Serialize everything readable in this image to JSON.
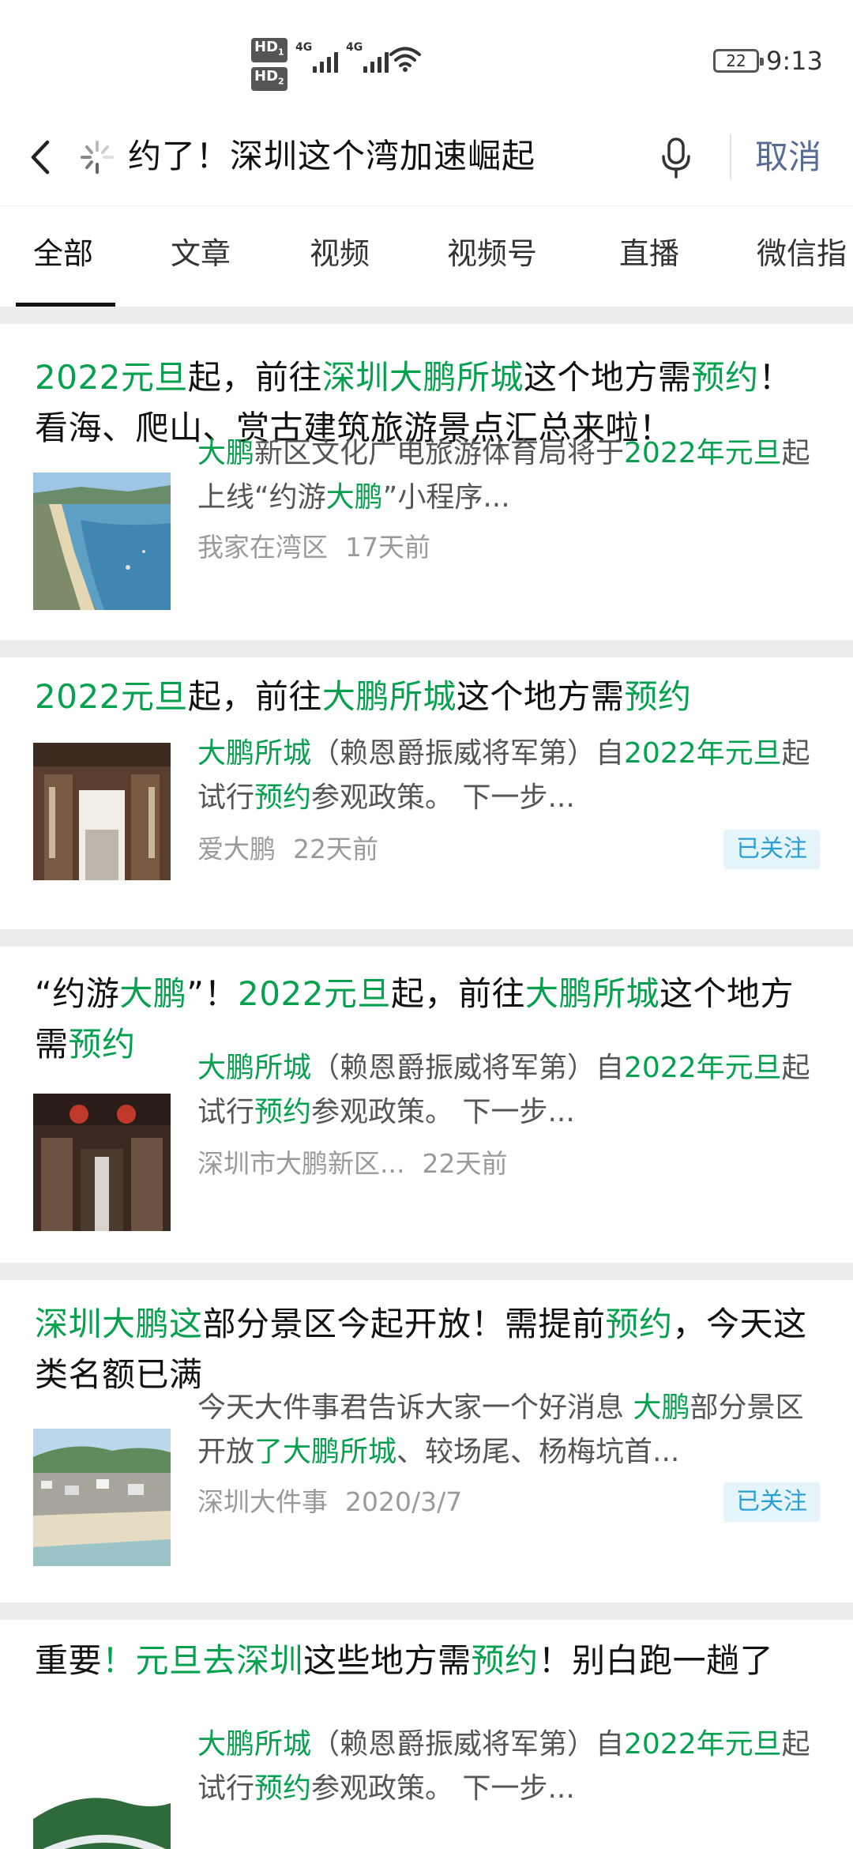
{
  "status_bar": {
    "hd1": "HD",
    "hd1_sub": "1",
    "hd2": "HD",
    "hd2_sub": "2",
    "net1": "4G",
    "net2": "4G",
    "battery": "22",
    "time": "9:13"
  },
  "search": {
    "query_visible": "约了！深圳这个湾加速崛起",
    "cancel_label": "取消"
  },
  "tabs": [
    {
      "label": "全部",
      "active": true
    },
    {
      "label": "文章",
      "active": false
    },
    {
      "label": "视频",
      "active": false
    },
    {
      "label": "视频号",
      "active": false
    },
    {
      "label": "直播",
      "active": false
    },
    {
      "label": "微信指",
      "active": false
    }
  ],
  "results": [
    {
      "title_segments": [
        {
          "text": "2022元旦",
          "hl": true
        },
        {
          "text": "起，前往",
          "hl": false
        },
        {
          "text": "深圳大鹏所城",
          "hl": true
        },
        {
          "text": "这个地方需",
          "hl": false
        },
        {
          "text": "预约",
          "hl": true
        },
        {
          "text": "！看海、爬山、赏古建筑旅游景点汇总来啦！",
          "hl": false
        }
      ],
      "desc_segments": [
        {
          "text": "大鹏",
          "hl": true
        },
        {
          "text": "新区文化广电旅游体育局将于",
          "hl": false
        },
        {
          "text": "2022年元旦",
          "hl": true
        },
        {
          "text": "起上线“约游",
          "hl": false
        },
        {
          "text": "大鹏",
          "hl": true
        },
        {
          "text": "”小程序...",
          "hl": false
        }
      ],
      "source": "我家在湾区",
      "time": "17天前",
      "followed": false,
      "thumb_icon": "coastline-photo"
    },
    {
      "title_segments": [
        {
          "text": "2022元旦",
          "hl": true
        },
        {
          "text": "起，前往",
          "hl": false
        },
        {
          "text": "大鹏所城",
          "hl": true
        },
        {
          "text": "这个地方需",
          "hl": false
        },
        {
          "text": "预约",
          "hl": true
        }
      ],
      "desc_segments": [
        {
          "text": "大鹏所城",
          "hl": true
        },
        {
          "text": "（赖恩爵振威将军第）自",
          "hl": false
        },
        {
          "text": "2022年元旦",
          "hl": true
        },
        {
          "text": "起试行",
          "hl": false
        },
        {
          "text": "预约",
          "hl": true
        },
        {
          "text": "参观政策。 下一步...",
          "hl": false
        }
      ],
      "source": "爱大鹏",
      "time": "22天前",
      "followed": true,
      "follow_label": "已关注",
      "thumb_icon": "gate-photo"
    },
    {
      "title_segments": [
        {
          "text": "“约游",
          "hl": false
        },
        {
          "text": "大鹏",
          "hl": true
        },
        {
          "text": "”！",
          "hl": false
        },
        {
          "text": "2022元旦",
          "hl": true
        },
        {
          "text": "起，前往",
          "hl": false
        },
        {
          "text": "大鹏所城",
          "hl": true
        },
        {
          "text": "这个地方需",
          "hl": false
        },
        {
          "text": "预约",
          "hl": true
        }
      ],
      "desc_segments": [
        {
          "text": "大鹏所城",
          "hl": true
        },
        {
          "text": "（赖恩爵振威将军第）自",
          "hl": false
        },
        {
          "text": "2022年元旦",
          "hl": true
        },
        {
          "text": "起试行",
          "hl": false
        },
        {
          "text": "预约",
          "hl": true
        },
        {
          "text": "参观政策。 下一步...",
          "hl": false
        }
      ],
      "source": "深圳市大鹏新区...",
      "time": "22天前",
      "followed": false,
      "thumb_icon": "lantern-gate-photo"
    },
    {
      "title_segments": [
        {
          "text": "深圳大鹏这",
          "hl": true
        },
        {
          "text": "部分景区今起开放！需提前",
          "hl": false
        },
        {
          "text": "预约",
          "hl": true
        },
        {
          "text": "，今天这类名额已满",
          "hl": false
        }
      ],
      "desc_segments": [
        {
          "text": "今天大件事君告诉大家一个好消息 ",
          "hl": false
        },
        {
          "text": "大鹏",
          "hl": true
        },
        {
          "text": "部分景区开放",
          "hl": false
        },
        {
          "text": "了大鹏所城",
          "hl": true
        },
        {
          "text": "、较场尾、杨梅坑首...",
          "hl": false
        }
      ],
      "source": "深圳大件事",
      "time": "2020/3/7",
      "followed": true,
      "follow_label": "已关注",
      "thumb_icon": "beach-town-photo"
    },
    {
      "title_segments": [
        {
          "text": "重要",
          "hl": false
        },
        {
          "text": "！元旦去深圳",
          "hl": true
        },
        {
          "text": "这些地方需",
          "hl": false
        },
        {
          "text": "预约",
          "hl": true
        },
        {
          "text": "！别白跑一趟了",
          "hl": false
        }
      ],
      "desc_segments": [
        {
          "text": "大鹏所城",
          "hl": true
        },
        {
          "text": "（赖恩爵振威将军第）自",
          "hl": false
        },
        {
          "text": "2022年元旦",
          "hl": true
        },
        {
          "text": "起试行",
          "hl": false
        },
        {
          "text": "预约",
          "hl": true
        },
        {
          "text": "参观政策。 下一步...",
          "hl": false
        }
      ],
      "source": "",
      "time": "",
      "followed": false,
      "thumb_icon": "hill-path-photo"
    }
  ]
}
